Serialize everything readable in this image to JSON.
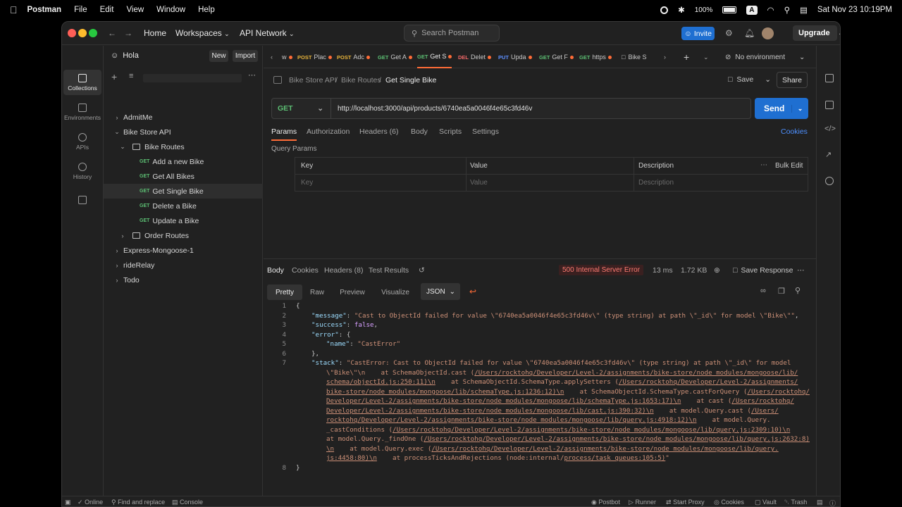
{
  "menubar": {
    "app": "Postman",
    "items": [
      "File",
      "Edit",
      "View",
      "Window",
      "Help"
    ],
    "battery": "100%",
    "kbd": "A",
    "datetime": "Sat Nov 23  10:19PM"
  },
  "titlebar": {
    "home": "Home",
    "workspaces": "Workspaces",
    "workspace_name": "API Network",
    "search_placeholder": "Search Postman",
    "invite": "Invite",
    "upgrade": "Upgrade"
  },
  "rail": {
    "items": [
      "Collections",
      "Environments",
      "APIs",
      "History"
    ]
  },
  "sidebar": {
    "workspace": "Hola",
    "new": "New",
    "import": "Import",
    "tree": [
      {
        "label": "AdmitMe"
      },
      {
        "label": "Bike Store API"
      },
      {
        "label": "Bike Routes"
      },
      {
        "method": "GET",
        "label": "Add a new Bike"
      },
      {
        "method": "GET",
        "label": "Get All Bikes"
      },
      {
        "method": "GET",
        "label": "Get Single Bike"
      },
      {
        "method": "GET",
        "label": "Delete a Bike"
      },
      {
        "method": "GET",
        "label": "Update a Bike"
      },
      {
        "label": "Order Routes"
      },
      {
        "label": "Express-Mongoose-1"
      },
      {
        "label": "rideRelay"
      },
      {
        "label": "Todo"
      }
    ]
  },
  "tabs": {
    "items": [
      {
        "method": "",
        "label": "w"
      },
      {
        "method": "POST",
        "label": "Plac"
      },
      {
        "method": "POST",
        "label": "Adc"
      },
      {
        "method": "GET",
        "label": "Get A"
      },
      {
        "method": "GET",
        "label": "Get S"
      },
      {
        "method": "DEL",
        "label": "Delet"
      },
      {
        "method": "PUT",
        "label": "Upda"
      },
      {
        "method": "GET",
        "label": "Get F"
      },
      {
        "method": "GET",
        "label": "https"
      },
      {
        "method": "",
        "label": "Bike S"
      }
    ],
    "environment": "No environment"
  },
  "request": {
    "breadcrumb": [
      "Bike Store API",
      "Bike Routes",
      "Get Single Bike"
    ],
    "separator": "/",
    "save": "Save",
    "share": "Share",
    "method": "GET",
    "url": "http://localhost:3000/api/products/6740ea5a0046f4e65c3fd46v",
    "send": "Send",
    "tabs": [
      "Params",
      "Authorization",
      "Headers (6)",
      "Body",
      "Scripts",
      "Settings"
    ],
    "cookies": "Cookies",
    "query_params_title": "Query Params",
    "columns": [
      "Key",
      "Value",
      "Description"
    ],
    "bulk_edit": "Bulk Edit",
    "placeholders": [
      "Key",
      "Value",
      "Description"
    ]
  },
  "response": {
    "tabs": [
      "Body",
      "Cookies",
      "Headers (8)",
      "Test Results"
    ],
    "status": "500 Internal Server Error",
    "time": "13 ms",
    "size": "1.72 KB",
    "save_response": "Save Response",
    "formats": [
      "Pretty",
      "Raw",
      "Preview",
      "Visualize"
    ],
    "language": "JSON",
    "line_numbers": [
      "1",
      "2",
      "3",
      "4",
      "5",
      "6",
      "7",
      "8"
    ],
    "lines": {
      "l1": "{",
      "l2_key": "\"message\"",
      "l2_val": "\"Cast to ObjectId failed for value \\\"6740ea5a0046f4e65c3fd46v\\\" (type string) at path \\\"_id\\\" for model \\\"Bike\\\"\"",
      "l3_key": "\"success\"",
      "l3_val": "false",
      "l4_key": "\"error\"",
      "l4_val": "{",
      "l5_key": "\"name\"",
      "l5_val": "\"CastError\"",
      "l6": "},",
      "l7_key": "\"stack\"",
      "l7_a": "\"CastError: Cast to ObjectId failed for value \\\"6740ea5a0046f4e65c3fd46v\\\" (type string) at path \\\"_id\\\" for model",
      "l7_b1": "\\\"Bike\\\"\\n    at SchemaObjectId.cast (",
      "l7_b2": "/Users/rocktohq/Developer/Level-2/assignments/bike-store/node_modules/mongoose/lib/",
      "l7_c1": "schema/objectId.js:250:11)\\n",
      "l7_c2": "    at SchemaObjectId.SchemaType.applySetters (",
      "l7_c3": "/Users/rocktohq/Developer/Level-2/assignments/",
      "l7_d1": "bike-store/node_modules/mongoose/lib/schemaType.js:1236:12)\\n",
      "l7_d2": "    at SchemaObjectId.SchemaType.castForQuery (",
      "l7_d3": "/Users/rocktohq/",
      "l7_e1": "Developer/Level-2/assignments/bike-store/node_modules/mongoose/lib/schemaType.js:1653:17)\\n",
      "l7_e2": "    at cast (",
      "l7_e3": "/Users/rocktohq/",
      "l7_f1": "Developer/Level-2/assignments/bike-store/node_modules/mongoose/lib/cast.js:390:32)\\n",
      "l7_f2": "    at model.Query.cast (",
      "l7_f3": "/Users/",
      "l7_g1": "rocktohq/Developer/Level-2/assignments/bike-store/node_modules/mongoose/lib/query.js:4918:12)\\n",
      "l7_g2": "    at model.Query.",
      "l7_h1": "_castConditions (",
      "l7_h2": "/Users/rocktohq/Developer/Level-2/assignments/bike-store/node_modules/mongoose/lib/query.js:2309:10)\\n",
      "l7_i1": "at model.Query._findOne (",
      "l7_i2": "/Users/rocktohq/Developer/Level-2/assignments/bike-store/node_modules/mongoose/lib/query.js:2632:8)",
      "l7_j1": "\\n",
      "l7_j2": "    at model.Query.exec (",
      "l7_j3": "/Users/rocktohq/Developer/Level-2/assignments/bike-store/node_modules/mongoose/lib/query.",
      "l7_k1": "js:4458:80)\\n",
      "l7_k2": "    at processTicksAndRejections (node:internal/",
      "l7_k3": "process/task_queues:105:5)",
      "l7_k4": "\"",
      "l8": "}"
    }
  },
  "statusbar": {
    "online": "Online",
    "find_replace": "Find and replace",
    "console": "Console",
    "postbot": "Postbot",
    "runner": "Runner",
    "start_proxy": "Start Proxy",
    "cookies": "Cookies",
    "vault": "Vault",
    "trash": "Trash"
  },
  "colors": {
    "accent": "#ff6c37",
    "primary_button": "#1f6fd1",
    "get": "#5cbf73",
    "post": "#e6b23a",
    "error": "#ff7b72"
  }
}
